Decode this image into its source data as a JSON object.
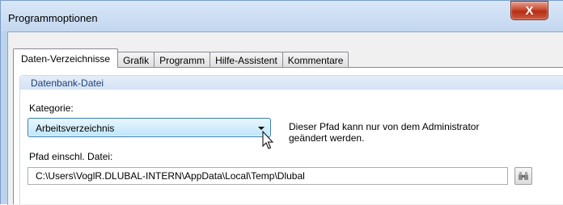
{
  "window": {
    "title": "Programmoptionen",
    "close_glyph": "X"
  },
  "tabs": [
    {
      "label": "Daten-Verzeichnisse",
      "active": true
    },
    {
      "label": "Grafik",
      "active": false
    },
    {
      "label": "Programm",
      "active": false
    },
    {
      "label": "Hilfe-Assistent",
      "active": false
    },
    {
      "label": "Kommentare",
      "active": false
    }
  ],
  "group": {
    "title": "Datenbank-Datei"
  },
  "kategorie": {
    "label": "Kategorie:",
    "value": "Arbeitsverzeichnis"
  },
  "note": {
    "line1": "Dieser Pfad kann nur von dem Administrator",
    "line2": "geändert werden."
  },
  "pfad": {
    "label": "Pfad einschl. Datei:",
    "value": "C:\\Users\\VoglR.DLUBAL-INTERN\\AppData\\Local\\Temp\\Dlubal"
  },
  "icons": {
    "close": "close-icon",
    "dropdown": "chevron-down-icon",
    "browse": "binoculars-icon",
    "cursor": "mouse-pointer-icon"
  }
}
